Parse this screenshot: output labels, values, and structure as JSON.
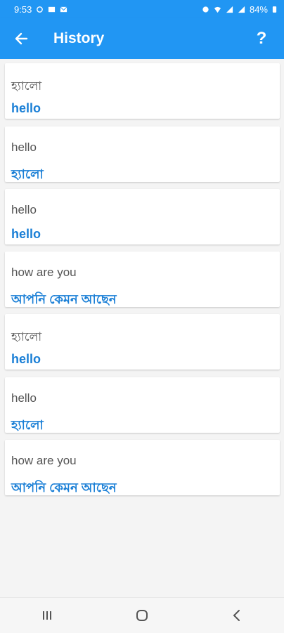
{
  "status_bar": {
    "time": "9:53",
    "battery": "84%",
    "signal_label": "VoLTE LTE1"
  },
  "app_bar": {
    "title": "History",
    "help_label": "?"
  },
  "history": [
    {
      "source": "হ্যালো",
      "translation": "hello"
    },
    {
      "source": "hello",
      "translation": "হ্যালো"
    },
    {
      "source": "hello",
      "translation": "hello"
    },
    {
      "source": "how are you",
      "translation": "আপনি কেমন আছেন"
    },
    {
      "source": "হ্যালো",
      "translation": "hello"
    },
    {
      "source": "hello",
      "translation": "হ্যালো"
    },
    {
      "source": "how are you",
      "translation": "আপনি কেমন আছেন"
    }
  ],
  "colors": {
    "primary": "#2196F3",
    "translation_text": "#1a7fd6",
    "source_text": "#555555"
  }
}
